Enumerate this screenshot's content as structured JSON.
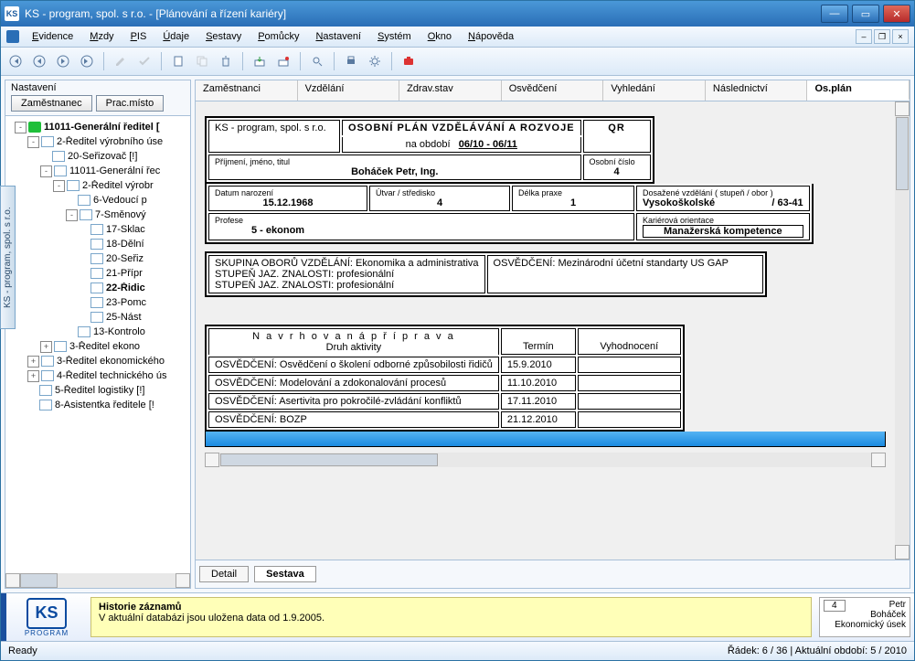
{
  "window": {
    "title": "KS - program, spol. s r.o. - [Plánování a řízení kariéry]"
  },
  "menu": {
    "items": [
      "Evidence",
      "Mzdy",
      "PIS",
      "Údaje",
      "Sestavy",
      "Pomůcky",
      "Nastavení",
      "Systém",
      "Okno",
      "Nápověda"
    ]
  },
  "sidebar": {
    "group": "Nastavení",
    "buttons": {
      "zam": "Zaměstnanec",
      "prac": "Prac.místo"
    },
    "tree": [
      {
        "d": 0,
        "exp": "-",
        "ico": "green",
        "lbl": "11011-Generální ředitel [",
        "bold": true
      },
      {
        "d": 1,
        "exp": "-",
        "ico": "doc",
        "lbl": "2-Ředitel výrobního úse"
      },
      {
        "d": 2,
        "exp": "",
        "ico": "doc",
        "lbl": "20-Seřizovač [!]"
      },
      {
        "d": 2,
        "exp": "-",
        "ico": "doc",
        "lbl": "11011-Generální řec"
      },
      {
        "d": 3,
        "exp": "-",
        "ico": "doc",
        "lbl": "2-Ředitel výrobr"
      },
      {
        "d": 4,
        "exp": "",
        "ico": "doc",
        "lbl": "6-Vedoucí p"
      },
      {
        "d": 4,
        "exp": "-",
        "ico": "doc",
        "lbl": "7-Směnový"
      },
      {
        "d": 5,
        "exp": "",
        "ico": "doc",
        "lbl": "17-Sklac"
      },
      {
        "d": 5,
        "exp": "",
        "ico": "doc",
        "lbl": "18-Dělní"
      },
      {
        "d": 5,
        "exp": "",
        "ico": "doc",
        "lbl": "20-Seřiz"
      },
      {
        "d": 5,
        "exp": "",
        "ico": "doc",
        "lbl": "21-Přípr"
      },
      {
        "d": 5,
        "exp": "",
        "ico": "doc",
        "lbl": "22-Řidic",
        "bold": true,
        "sel": true
      },
      {
        "d": 5,
        "exp": "",
        "ico": "doc",
        "lbl": "23-Pomc"
      },
      {
        "d": 5,
        "exp": "",
        "ico": "doc",
        "lbl": "25-Nást"
      },
      {
        "d": 4,
        "exp": "",
        "ico": "doc",
        "lbl": "13-Kontrolo"
      },
      {
        "d": 2,
        "exp": "+",
        "ico": "doc",
        "lbl": "3-Ředitel ekono"
      },
      {
        "d": 1,
        "exp": "+",
        "ico": "doc",
        "lbl": "3-Ředitel ekonomického"
      },
      {
        "d": 1,
        "exp": "+",
        "ico": "doc",
        "lbl": "4-Ředitel technického ús"
      },
      {
        "d": 1,
        "exp": "",
        "ico": "doc",
        "lbl": "5-Ředitel logistiky [!]"
      },
      {
        "d": 1,
        "exp": "",
        "ico": "doc",
        "lbl": "8-Asistentka ředitele [!"
      }
    ]
  },
  "tabs": [
    "Zaměstnanci",
    "Vzdělání",
    "Zdrav.stav",
    "Osvědčení",
    "Vyhledání",
    "Následnictví",
    "Os.plán"
  ],
  "active_tab": 6,
  "doc": {
    "company": "KS - program, spol. s r.o.",
    "title": "OSOBNÍ PLÁN VZDĚLÁVÁNÍ A ROZVOJE",
    "period_lbl": "na období",
    "period": "06/10 - 06/11",
    "qr": "QR",
    "name_h": "Příjmení, jméno, titul",
    "name": "Boháček Petr, Ing.",
    "osc_h": "Osobní číslo",
    "osc": "4",
    "dob_h": "Datum narození",
    "dob": "15.12.1968",
    "utvar_h": "Útvar / středisko",
    "utvar": "4",
    "praxe_h": "Délka praxe",
    "praxe": "1",
    "vzdel_h": "Dosažené vzdělání ( stupeň / obor )",
    "vzdel": "Vysokoškolské",
    "vzdel2": "/ 63-41",
    "profese_h": "Profese",
    "profese": "5 - ekonom",
    "kariera_h": "Kariérová orientace",
    "kariera": "Manažerská kompetence",
    "skupina": "SKUPINA OBORŮ VZDĚLÁNÍ: Ekonomika a administrativa",
    "jaz1": "STUPEŇ JAZ. ZNALOSTI: profesionální",
    "jaz2": "STUPEŇ JAZ. ZNALOSTI: profesionální",
    "osved": "OSVĚDČENÍ: Mezinárodní účetní standarty US GAP",
    "prep_title": "N a v r h o v a n á   p ř í p r a v a",
    "prep_sub": "Druh aktivity",
    "col_termin": "Termín",
    "col_vyhod": "Vyhodnocení",
    "rows": [
      {
        "a": "OSVĚDČENÍ: Osvědčení o školení odborné způsobilosti řidičů",
        "t": "15.9.2010",
        "v": ""
      },
      {
        "a": "OSVĚDČENÍ: Modelování a zdokonalování procesů",
        "t": "11.10.2010",
        "v": ""
      },
      {
        "a": "OSVĚDČENÍ: Asertivita pro pokročilé-zvládání konfliktů",
        "t": "17.11.2010",
        "v": ""
      },
      {
        "a": "OSVĚDČENÍ: BOZP",
        "t": "21.12.2010",
        "v": ""
      }
    ]
  },
  "bottom_tabs": {
    "detail": "Detail",
    "sestava": "Sestava"
  },
  "footer": {
    "history_title": "Historie záznamů",
    "history_text": "V aktuální databázi jsou uložena data od 1.9.2005.",
    "person_num": "4",
    "person_first": "Petr",
    "person_last": "Boháček",
    "person_dept": "Ekonomický úsek",
    "logo_sub": "PROGRAM"
  },
  "status": {
    "left": "Ready",
    "right": "Řádek: 6 / 36  | Aktuální období: 5 / 2010"
  },
  "side_tab": "KS - program, spol. s r.o."
}
